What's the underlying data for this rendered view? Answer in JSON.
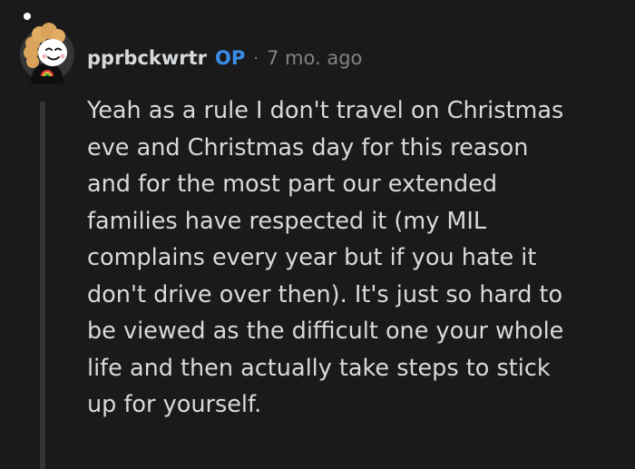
{
  "comment": {
    "author": "pprbckwrtr",
    "badge": "OP",
    "separator": "·",
    "timestamp": "7 mo. ago",
    "avatar_icon": "snoo-avatar-icon",
    "body_lines": [
      "Yeah as a rule I don't travel on Christmas",
      "eve and Christmas day for this reason",
      "and for the most part our extended",
      "families have respected it (my MIL",
      "complains every year but if you hate it",
      "don't drive over then). It's just so hard to",
      "be viewed as the difficult one your whole",
      "life and then actually take steps to stick",
      "up for yourself."
    ]
  },
  "colors": {
    "background": "#1a1a1b",
    "text": "#d7dadc",
    "muted": "#818384",
    "op_badge": "#3a8eea",
    "thread_line": "#343536"
  }
}
